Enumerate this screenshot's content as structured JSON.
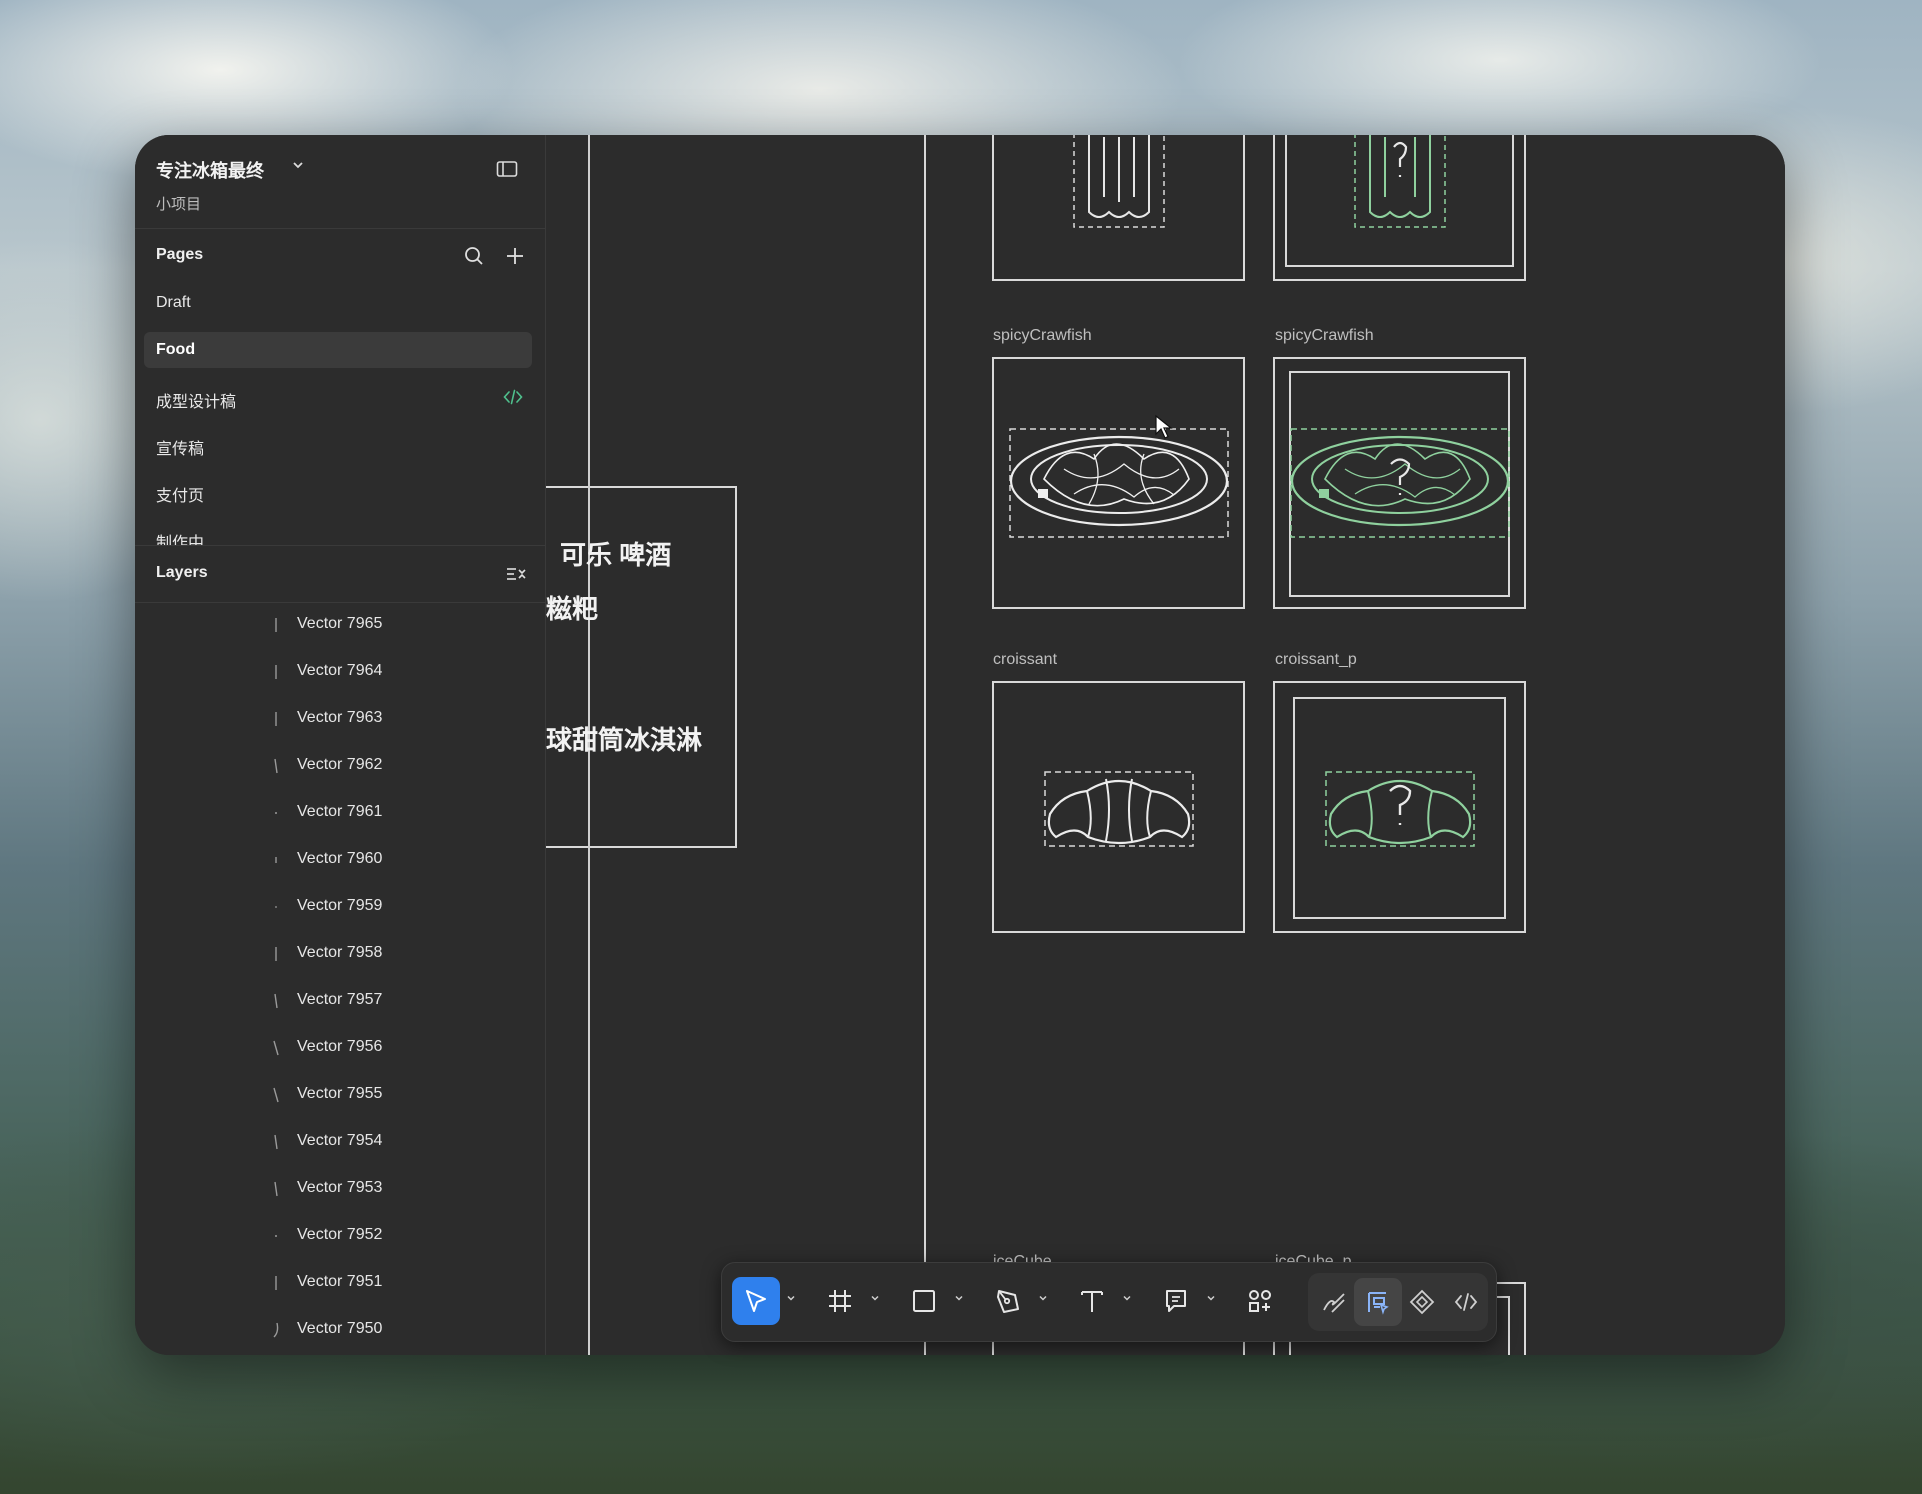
{
  "file": {
    "title": "专注冰箱最终",
    "subtitle": "小项目"
  },
  "pages": {
    "heading": "Pages",
    "items": [
      {
        "label": "Draft",
        "active": false
      },
      {
        "label": "Food",
        "active": true
      },
      {
        "label": "成型设计稿",
        "active": false,
        "code_icon": true
      },
      {
        "label": "宣传稿",
        "active": false
      },
      {
        "label": "支付页",
        "active": false
      },
      {
        "label": "制作中",
        "active": false
      }
    ]
  },
  "layers": {
    "heading": "Layers",
    "items": [
      "Vector 7965",
      "Vector 7964",
      "Vector 7963",
      "Vector 7962",
      "Vector 7961",
      "Vector 7960",
      "Vector 7959",
      "Vector 7958",
      "Vector 7957",
      "Vector 7956",
      "Vector 7955",
      "Vector 7954",
      "Vector 7953",
      "Vector 7952",
      "Vector 7951",
      "Vector 7950"
    ]
  },
  "canvas": {
    "frames": {
      "spicy_left": "spicyCrawfish",
      "spicy_right": "spicyCrawfish",
      "croissant_left": "croissant",
      "croissant_right": "croissant_p",
      "icecube_left": "iceCube",
      "icecube_right": "iceCube_p"
    },
    "menu_board": {
      "line1": "可乐    啤酒",
      "line2": "糍粑",
      "line3": "球甜筒冰淇淋"
    }
  },
  "toolbar": {
    "tools": [
      "move-tool",
      "frame-tool",
      "shape-tool",
      "pen-tool",
      "text-tool",
      "comment-tool",
      "assets-tool",
      "draw-mode",
      "design-mode",
      "dev-mode-component",
      "dev-mode"
    ],
    "active_tool": "move-tool"
  },
  "colors": {
    "panel_bg": "#2c2c2c",
    "accent": "#2f80ed",
    "green_outline": "#8fd19e",
    "code_green": "#4fc08d"
  }
}
